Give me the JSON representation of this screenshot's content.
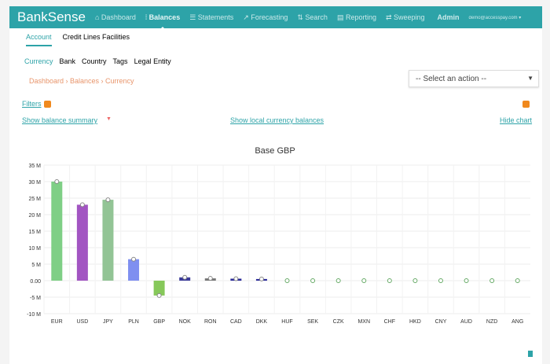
{
  "nav": {
    "brand": "BankSense",
    "items": [
      {
        "label": "⌂ Dashboard"
      },
      {
        "label": "⫶ Balances",
        "active": true
      },
      {
        "label": "☰ Statements"
      },
      {
        "label": "↗ Forecasting"
      },
      {
        "label": "⇅ Search"
      },
      {
        "label": "▤ Reporting"
      },
      {
        "label": "⇄ Sweeping"
      },
      {
        "label": "Admin"
      },
      {
        "label": "demo@accesspay.com ▾"
      }
    ]
  },
  "subtabs": [
    "Account",
    "Credit Lines Facilities"
  ],
  "groupings": [
    "Currency",
    "Bank",
    "Country",
    "Tags",
    "Legal Entity"
  ],
  "breadcrumb": "Dashboard › Balances › Currency",
  "action_select": {
    "value": "-- Select an action --"
  },
  "filters_label": "Filters",
  "show_summary": "Show balance summary",
  "show_local": "Show local currency balances",
  "hide_chart": "Hide chart",
  "colors": {
    "accent": "#2da3a8",
    "badge": "#f0891e"
  },
  "chart_data": {
    "type": "bar",
    "title": "Base GBP",
    "categories": [
      "EUR",
      "USD",
      "JPY",
      "PLN",
      "GBP",
      "NOK",
      "RON",
      "CAD",
      "DKK",
      "HUF",
      "SEK",
      "CZK",
      "MXN",
      "CHF",
      "HKD",
      "CNY",
      "AUD",
      "NZD",
      "ANG"
    ],
    "values": [
      30,
      23,
      24.5,
      6.5,
      -4.5,
      1,
      0.7,
      0.6,
      0.5,
      0,
      0,
      0,
      0,
      0,
      0,
      0,
      0,
      0,
      0
    ],
    "bar_colors": [
      "#7fcf86",
      "#a255c2",
      "#92c495",
      "#7f8ff0",
      "#86c85a",
      "#3c3c9a",
      "#777",
      "#2c2c9a",
      "#2c2c9a",
      "#999",
      "#999",
      "#999",
      "#999",
      "#999",
      "#999",
      "#999",
      "#999",
      "#999",
      "#999"
    ],
    "yticks": [
      "35 M",
      "30 M",
      "25 M",
      "20 M",
      "15 M",
      "10 M",
      "5 M",
      "0.00",
      "-5 M",
      "-10 M"
    ],
    "ylim": [
      -10,
      35
    ],
    "unit": "M",
    "grid": true
  }
}
